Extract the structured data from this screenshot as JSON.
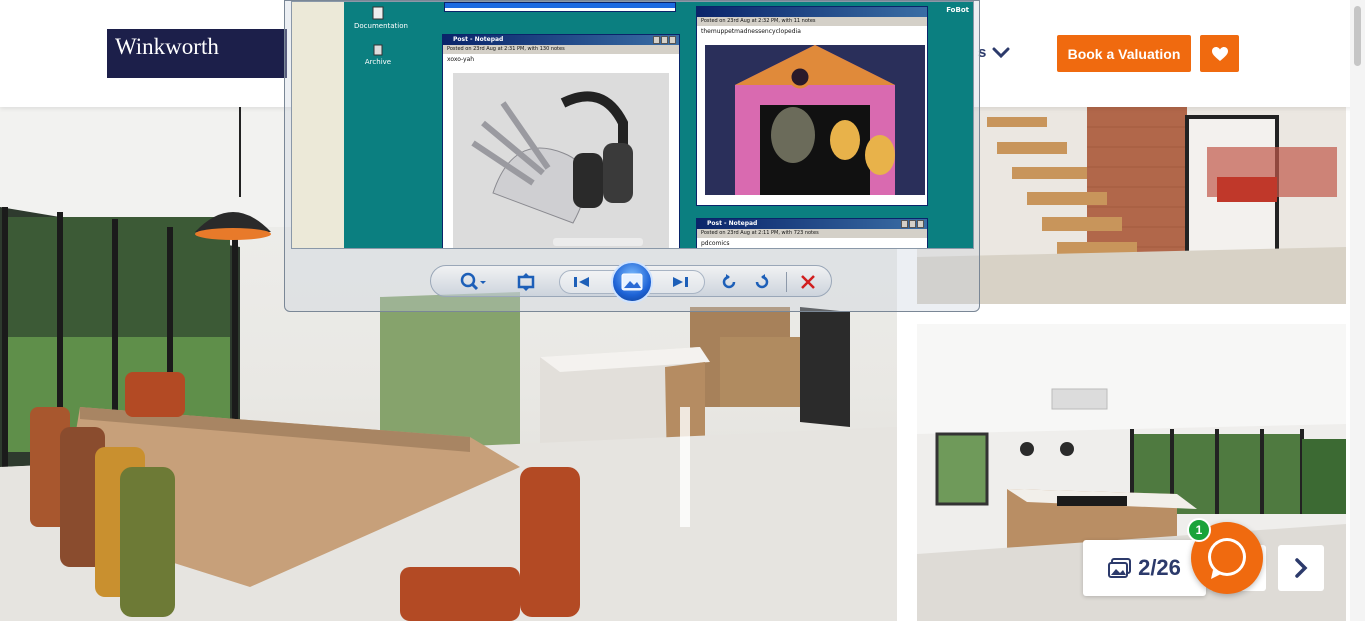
{
  "header": {
    "logo_text": "Winkworth",
    "nav_fragment": "s",
    "valuation_button": "Book a Valuation",
    "brand_color": "#f06a0f",
    "navy_color": "#1c1f4a"
  },
  "gallery": {
    "counter": "2/26",
    "chat_badge": "1"
  },
  "viewer": {
    "desktop_icons": [
      "Documentation",
      "Archive"
    ],
    "brand": "FoBot",
    "notes": [
      {
        "title": "Post - Notepad",
        "info": "Posted on 23rd Aug at 2:31 PM, with 130 notes",
        "user": "xoxo-yah"
      },
      {
        "title": "Post - Notepad",
        "info": "Posted on 23rd Aug at 2:32 PM, with 11 notes",
        "user": "themuppetmadnessencyclopedia"
      },
      {
        "title": "Post - Notepad",
        "info": "Posted on 23rd Aug at 2:11 PM, with 723 notes",
        "user": "pdcomics"
      }
    ]
  }
}
